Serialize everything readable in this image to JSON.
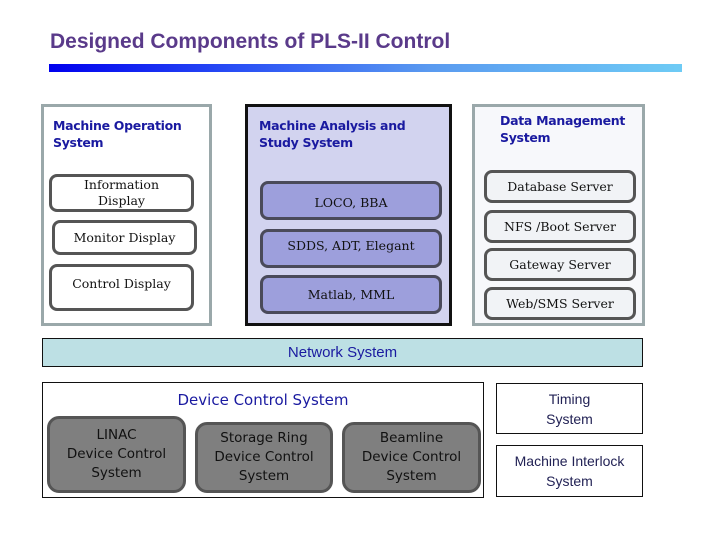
{
  "title": "Designed Components of PLS-II Control",
  "colors": {
    "title": "#5a3a8a",
    "group_label": "#1a1aa0",
    "analysis_fill": "#d2d3ef",
    "analysis_item_fill": "#9d9fdc",
    "network_fill": "#bde0e4",
    "device_item_fill": "#7f7f7f"
  },
  "machine_operation": {
    "label_line1": "Machine Operation",
    "label_line2": "System",
    "items": [
      {
        "line1": "Information",
        "line2": "Display"
      },
      {
        "line1": "Monitor Display",
        "line2": ""
      },
      {
        "line1": "Control Display",
        "line2": ""
      }
    ]
  },
  "machine_analysis": {
    "label_line1": "Machine Analysis  and",
    "label_line2": "Study System",
    "items": [
      "LOCO, BBA",
      "SDDS, ADT, Elegant",
      "Matlab, MML"
    ]
  },
  "data_management": {
    "label_line1": "Data Management",
    "label_line2": "System",
    "items": [
      "Database Server",
      "NFS /Boot Server",
      "Gateway Server",
      "Web/SMS Server"
    ]
  },
  "network": {
    "label": "Network System"
  },
  "device_control": {
    "label": "Device Control System",
    "items": [
      {
        "line1": "LINAC",
        "line2": "Device Control",
        "line3": "System"
      },
      {
        "line1": "Storage Ring",
        "line2": "Device Control",
        "line3": "System"
      },
      {
        "line1": "Beamline",
        "line2": "Device Control",
        "line3": "System"
      }
    ]
  },
  "timing": {
    "line1": "Timing",
    "line2": "System"
  },
  "interlock": {
    "line1": "Machine Interlock",
    "line2": "System"
  }
}
